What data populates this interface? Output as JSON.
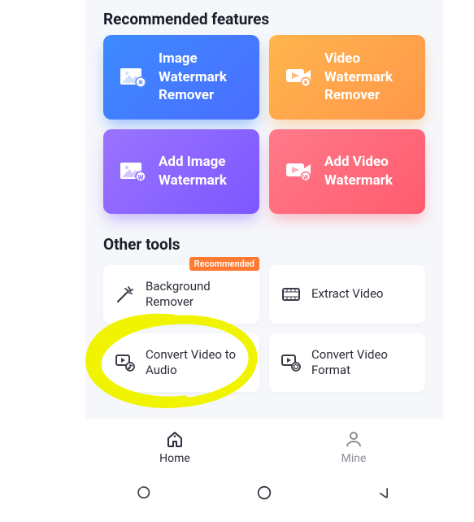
{
  "recommended": {
    "title": "Recommended features",
    "cards": [
      {
        "label": "Image Watermark Remover",
        "icon": "image-remove"
      },
      {
        "label": "Video Watermark Remover",
        "icon": "video-remove"
      },
      {
        "label": "Add Image Watermark",
        "icon": "image-add"
      },
      {
        "label": "Add Video Watermark",
        "icon": "video-add"
      }
    ]
  },
  "other": {
    "title": "Other tools",
    "tag_recommended": "Recommended",
    "cards": [
      {
        "label": "Background Remover",
        "icon": "wand",
        "tagged": true
      },
      {
        "label": "Extract Video",
        "icon": "film"
      },
      {
        "label": "Convert Video to Audio",
        "icon": "media-audio"
      },
      {
        "label": "Convert Video Format",
        "icon": "media-convert"
      }
    ]
  },
  "nav": {
    "home": "Home",
    "mine": "Mine"
  },
  "annotation": {
    "highlight_target": "convert-video-to-audio",
    "color": "#f4f500"
  }
}
